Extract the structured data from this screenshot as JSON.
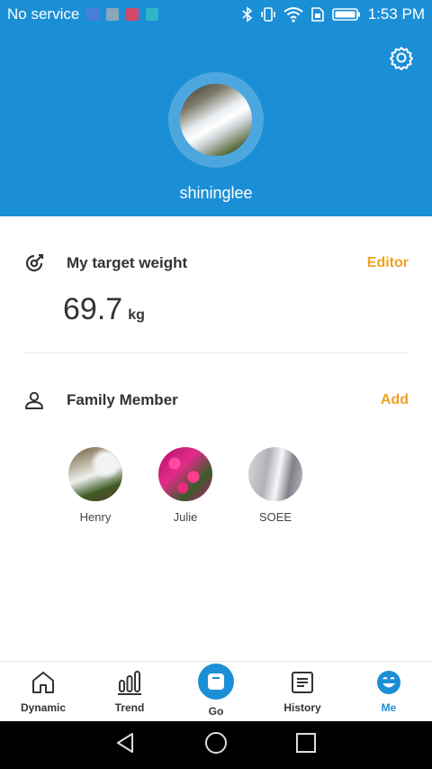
{
  "status_bar": {
    "carrier": "No service",
    "time": "1:53 PM",
    "colors": {
      "bg": "#1b8fd6"
    }
  },
  "header": {
    "username": "shininglee",
    "settings_icon": "gear-icon",
    "avatar_icon": "profile-avatar"
  },
  "target": {
    "title": "My target weight",
    "action": "Editor",
    "value": "69.7",
    "unit": "kg",
    "icon": "target-icon"
  },
  "family": {
    "title": "Family Member",
    "action": "Add",
    "icon": "person-icon",
    "members": [
      {
        "name": "Henry"
      },
      {
        "name": "Julie"
      },
      {
        "name": "SOEE"
      }
    ]
  },
  "nav": {
    "items": [
      {
        "label": "Dynamic",
        "icon": "home-icon"
      },
      {
        "label": "Trend",
        "icon": "bar-chart-icon"
      },
      {
        "label": "Go",
        "icon": "scale-icon"
      },
      {
        "label": "History",
        "icon": "list-icon"
      },
      {
        "label": "Me",
        "icon": "smiley-icon"
      }
    ],
    "active": "Me"
  },
  "colors": {
    "accent": "#1b8fd6",
    "action": "#f0a020"
  }
}
